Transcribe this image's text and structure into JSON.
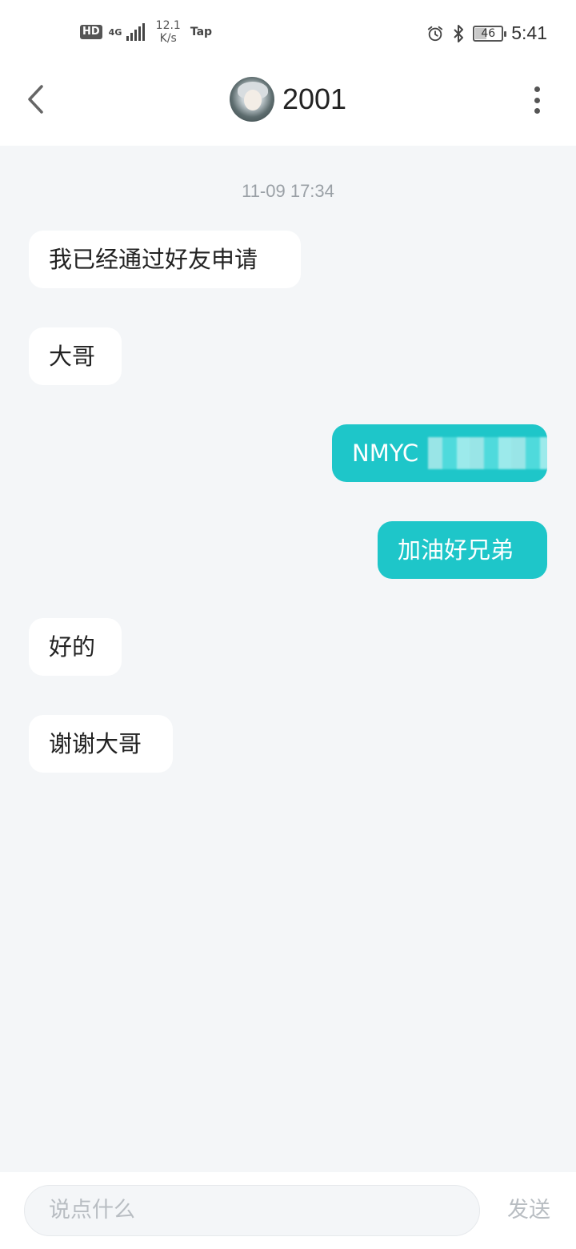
{
  "status_bar": {
    "hd": "HD",
    "network": "4G",
    "speed_value": "12.1",
    "speed_unit": "K/s",
    "app_icon": "Tap",
    "battery_level": "46",
    "time": "5:41"
  },
  "header": {
    "title": "2001"
  },
  "chat": {
    "timestamp": "11-09 17:34",
    "messages": [
      {
        "direction": "in",
        "text": "我已经通过好友申请"
      },
      {
        "direction": "in",
        "text": "大哥"
      },
      {
        "direction": "out",
        "text": "NMYC"
      },
      {
        "direction": "out",
        "text": "加油好兄弟"
      },
      {
        "direction": "in",
        "text": "好的"
      },
      {
        "direction": "in",
        "text": "谢谢大哥"
      }
    ]
  },
  "input_bar": {
    "placeholder": "说点什么",
    "send_label": "发送"
  },
  "colors": {
    "outgoing_bubble": "#1ec6c9",
    "incoming_bubble": "#ffffff",
    "chat_background": "#f4f6f8"
  }
}
